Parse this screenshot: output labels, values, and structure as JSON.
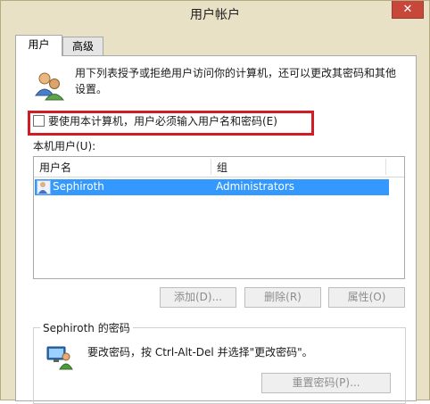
{
  "window": {
    "title": "用户帐户",
    "close_label": "✕"
  },
  "tabs": [
    {
      "label": "用户",
      "selected": true
    },
    {
      "label": "高级",
      "selected": false
    }
  ],
  "users_tab": {
    "description": "用下列表授予或拒绝用户访问你的计算机，还可以更改其密码和其他设置。",
    "require_password_checkbox": {
      "label": "要使用本计算机，用户必须输入用户名和密码(E)",
      "checked": false
    },
    "list_label": "本机用户(U):",
    "list_columns": [
      "用户名",
      "组"
    ],
    "list_rows": [
      {
        "name": "Sephiroth",
        "group": "Administrators",
        "selected": true
      }
    ],
    "buttons": {
      "add": "添加(D)...",
      "remove": "删除(R)",
      "properties": "属性(O)"
    },
    "password_group": {
      "title": "Sephiroth 的密码",
      "text": "要改密码，按 Ctrl-Alt-Del 并选择\"更改密码\"。",
      "reset_button": "重置密码(P)..."
    }
  },
  "colors": {
    "selection": "#3399ff",
    "highlight_border": "#d11b25",
    "close_button": "#c7473b",
    "frame": "#e8e1c6"
  },
  "icons": [
    "users-icon",
    "user-row-icon",
    "password-icon",
    "close-icon"
  ]
}
